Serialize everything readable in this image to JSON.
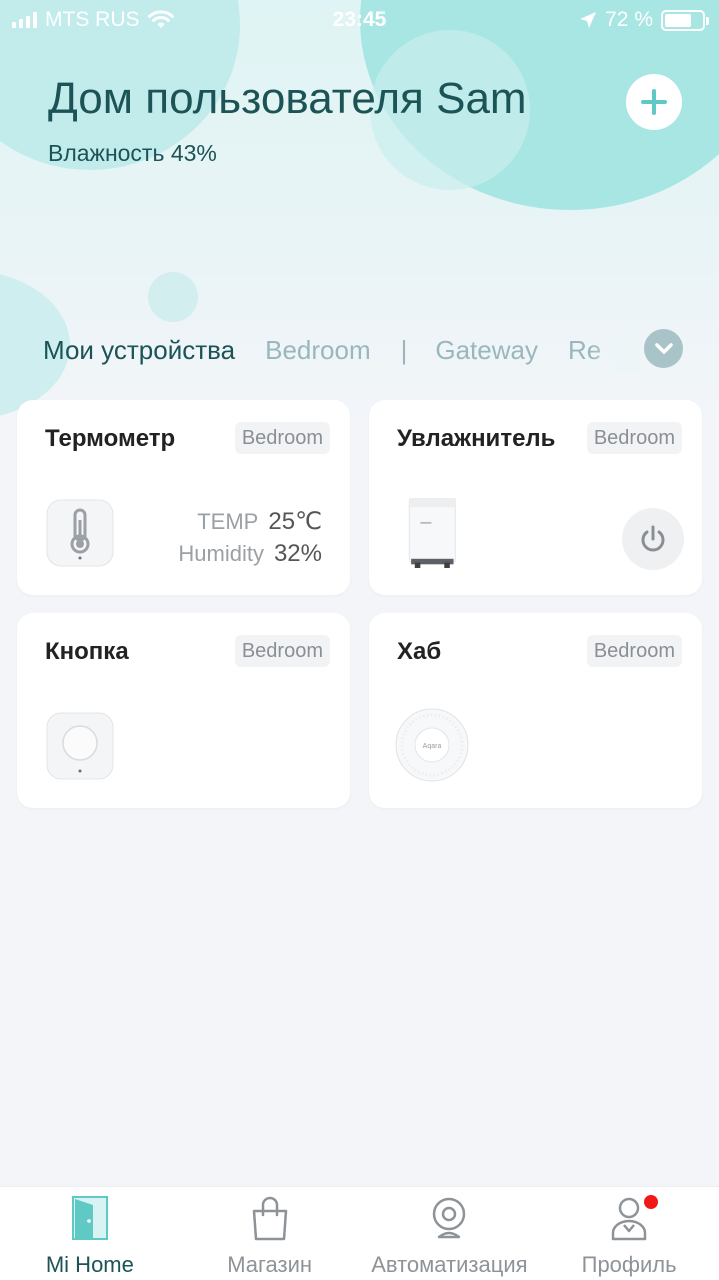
{
  "status_bar": {
    "carrier": "MTS RUS",
    "time": "23:45",
    "battery": "72 %",
    "battery_level": 0.72
  },
  "header": {
    "title": "Дом пользователя Sam",
    "humidity": "Влажность 43%"
  },
  "tabs": [
    {
      "label": "Мои устройства",
      "active": true
    },
    {
      "label": "Bedroom"
    },
    {
      "label": "Gateway"
    },
    {
      "label": "Re"
    }
  ],
  "devices": [
    {
      "name": "Термометр",
      "room": "Bedroom",
      "icon": "thermometer-sensor-icon",
      "readings": [
        {
          "label": "TEMP",
          "value": "25℃"
        },
        {
          "label": "Humidity",
          "value": "32%"
        }
      ]
    },
    {
      "name": "Увлажнитель",
      "room": "Bedroom",
      "icon": "humidifier-icon"
    },
    {
      "name": "Кнопка",
      "room": "Bedroom",
      "icon": "wireless-button-icon"
    },
    {
      "name": "Хаб",
      "room": "Bedroom",
      "icon": "hub-icon",
      "hub_label": "Aqara"
    }
  ],
  "nav": [
    {
      "label": "Mi Home",
      "icon": "door-icon",
      "active": true
    },
    {
      "label": "Магазин",
      "icon": "shopping-bag-icon"
    },
    {
      "label": "Автоматизация",
      "icon": "camera-icon"
    },
    {
      "label": "Профиль",
      "icon": "profile-icon",
      "badge": true
    }
  ],
  "colors": {
    "accent": "#1c5356",
    "teal": "#5fc9c6",
    "badge": "#f21818"
  }
}
